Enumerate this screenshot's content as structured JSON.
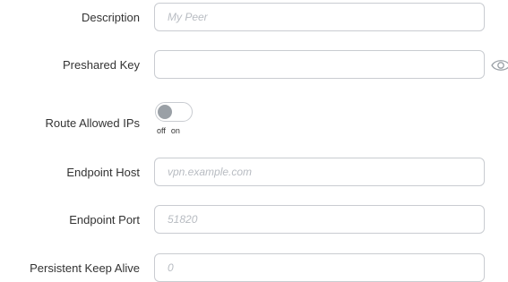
{
  "form": {
    "description": {
      "label": "Description",
      "placeholder": "My Peer",
      "value": ""
    },
    "preshared_key": {
      "label": "Preshared Key",
      "placeholder": "",
      "value": ""
    },
    "route_allowed_ips": {
      "label": "Route Allowed IPs",
      "off_label": "off",
      "on_label": "on",
      "state": "off"
    },
    "endpoint_host": {
      "label": "Endpoint Host",
      "placeholder": "vpn.example.com",
      "value": ""
    },
    "endpoint_port": {
      "label": "Endpoint Port",
      "placeholder": "51820",
      "value": ""
    },
    "keep_alive": {
      "label": "Persistent Keep Alive",
      "placeholder": "0",
      "value": ""
    }
  },
  "icons": {
    "reveal": "eye-icon"
  },
  "colors": {
    "border": "#c9ccd1",
    "placeholder": "#b8bcc2",
    "knob": "#9aa0a6",
    "text": "#333333"
  }
}
